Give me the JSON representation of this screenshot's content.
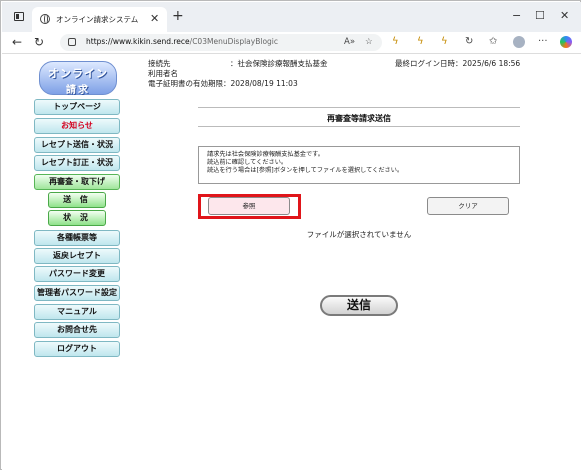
{
  "browser": {
    "tab_title": "オンライン請求システム",
    "tab_close": "✕",
    "new_tab": "+",
    "minimize": "−",
    "maximize": "☐",
    "close": "✕",
    "back": "←",
    "reload": "↻",
    "url_host": "https://www.kikin.send.rece",
    "url_path": "/C03MenuDisplayBlogic",
    "read_aloud": "A»",
    "favorite": "☆",
    "refresh_ext": "↻",
    "favorites_bar": "✩",
    "more": "···"
  },
  "logo": {
    "line1": "オンライン",
    "line2": "請求"
  },
  "menu": {
    "top": "トップページ",
    "notice": "お知らせ",
    "receipt_send": "レセプト送信・状況",
    "receipt_fix": "レセプト訂正・状況",
    "reexam": "再審査・取下げ",
    "send": "送 信",
    "status": "状 況",
    "forms": "各種帳票等",
    "returned": "返戻レセプト",
    "password": "パスワード変更",
    "admin_password": "管理者パスワード設定",
    "manual": "マニュアル",
    "contact": "お問合せ先",
    "logout": "ログアウト"
  },
  "header_info": {
    "destination_label": "接続先",
    "destination_value": "：社会保険診療報酬支払基金",
    "user_label": "利用者名",
    "cert_expiry": "電子証明書の有効期限：2028/08/19 11:03",
    "last_login": "最終ログイン日時：2025/6/6 18:56"
  },
  "main": {
    "title": "再審査等請求送信",
    "notice_line1": "請求先は社会保険診療報酬支払基金です。",
    "notice_line2": "読込前に確認してください。",
    "notice_line3": "読込を行う場合は[参照]ボタンを押してファイルを選択してください。",
    "browse_label": "参照",
    "clear_label": "クリア",
    "file_status": "ファイルが選択されていません",
    "send_label": "送信"
  },
  "colors": {
    "highlight": "#e0151a",
    "menu_blue": "#bfe6ed",
    "menu_green": "#9fe59a",
    "notice_red": "#d4001e"
  }
}
